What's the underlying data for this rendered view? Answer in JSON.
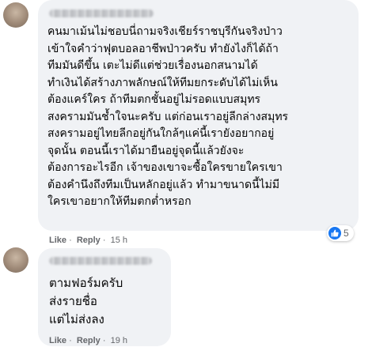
{
  "comments": [
    {
      "text_lines": [
        "คนมาเม้นไม่ชอบนี่ถามจริงเชียร์ราชบุรีกันจริงป่าว",
        "เข้าใจคำว่าฟุตบอลอาชีพป่าวครับ ทำยังไงก็ได้ถ้า",
        "ทีมมันดีขึ้น เตะไม่ดีแต่ช่วยเรื่องนอกสนามได้",
        "ทำเงินได้สร้างภาพลักษณ์ให้ทีมยกระดับได้ไม่เห็น",
        "ต้องแคร์ใคร ถ้าทีมตกชั้นอยู่ไม่รอดแบบสมุทร",
        "สงครามมันช้ำใจนะครับ แต่ก่อนเราอยู่ลีกล่างสมุทร",
        "สงครามอยู่ไทยลีกอยู่กันใกล้ๆแค่นี้เรายังอยากอยู่",
        "จุดนั้น ตอนนี้เราได้มายืนอยู่จุดนี้แล้วยังจะ",
        "ต้องการอะไรอีก เจ้าของเขาจะซื้อใครขายใครเขา",
        "ต้องคำนึงถึงทีมเป็นหลักอยู่แล้ว ทำมาขนาดนี้ไม่มี",
        "ใครเขาอยากให้ทีมตกต่ำหรอก"
      ],
      "like_label": "Like",
      "reply_label": "Reply",
      "separator": "·",
      "time": "15 h",
      "reaction_count": "5"
    },
    {
      "text_lines": [
        "ตามฟอร์มครับ",
        "ส่งรายชื่อ",
        "แต่ไม่ส่งลง"
      ],
      "like_label": "Like",
      "reply_label": "Reply",
      "separator": "·",
      "time": "19 h"
    }
  ],
  "colors": {
    "bubble": "#f0f2f5",
    "text": "#050505",
    "meta": "#65676b",
    "like_blue": "#1877f2"
  },
  "icons": {
    "reaction": "thumbs-up-icon"
  }
}
